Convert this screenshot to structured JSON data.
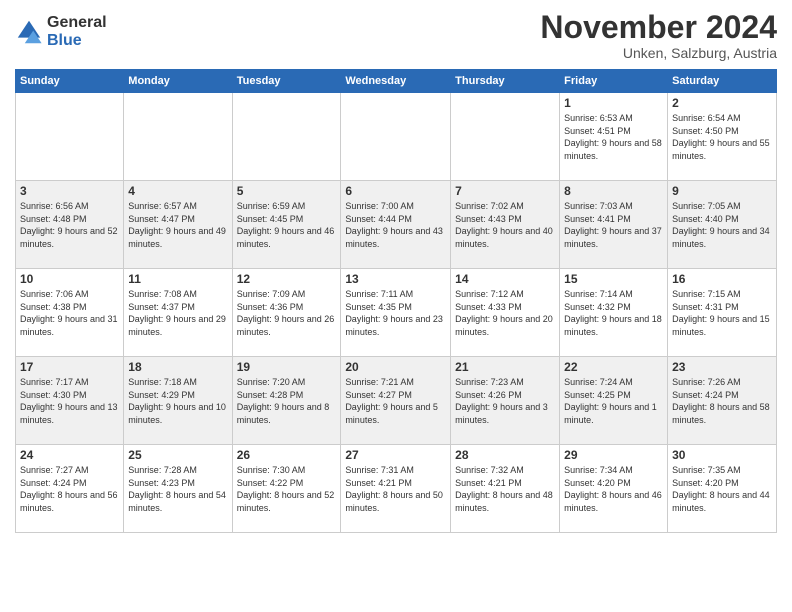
{
  "logo": {
    "general": "General",
    "blue": "Blue"
  },
  "header": {
    "title": "November 2024",
    "subtitle": "Unken, Salzburg, Austria"
  },
  "days_of_week": [
    "Sunday",
    "Monday",
    "Tuesday",
    "Wednesday",
    "Thursday",
    "Friday",
    "Saturday"
  ],
  "weeks": [
    [
      {
        "day": "",
        "info": ""
      },
      {
        "day": "",
        "info": ""
      },
      {
        "day": "",
        "info": ""
      },
      {
        "day": "",
        "info": ""
      },
      {
        "day": "",
        "info": ""
      },
      {
        "day": "1",
        "info": "Sunrise: 6:53 AM\nSunset: 4:51 PM\nDaylight: 9 hours and 58 minutes."
      },
      {
        "day": "2",
        "info": "Sunrise: 6:54 AM\nSunset: 4:50 PM\nDaylight: 9 hours and 55 minutes."
      }
    ],
    [
      {
        "day": "3",
        "info": "Sunrise: 6:56 AM\nSunset: 4:48 PM\nDaylight: 9 hours and 52 minutes."
      },
      {
        "day": "4",
        "info": "Sunrise: 6:57 AM\nSunset: 4:47 PM\nDaylight: 9 hours and 49 minutes."
      },
      {
        "day": "5",
        "info": "Sunrise: 6:59 AM\nSunset: 4:45 PM\nDaylight: 9 hours and 46 minutes."
      },
      {
        "day": "6",
        "info": "Sunrise: 7:00 AM\nSunset: 4:44 PM\nDaylight: 9 hours and 43 minutes."
      },
      {
        "day": "7",
        "info": "Sunrise: 7:02 AM\nSunset: 4:43 PM\nDaylight: 9 hours and 40 minutes."
      },
      {
        "day": "8",
        "info": "Sunrise: 7:03 AM\nSunset: 4:41 PM\nDaylight: 9 hours and 37 minutes."
      },
      {
        "day": "9",
        "info": "Sunrise: 7:05 AM\nSunset: 4:40 PM\nDaylight: 9 hours and 34 minutes."
      }
    ],
    [
      {
        "day": "10",
        "info": "Sunrise: 7:06 AM\nSunset: 4:38 PM\nDaylight: 9 hours and 31 minutes."
      },
      {
        "day": "11",
        "info": "Sunrise: 7:08 AM\nSunset: 4:37 PM\nDaylight: 9 hours and 29 minutes."
      },
      {
        "day": "12",
        "info": "Sunrise: 7:09 AM\nSunset: 4:36 PM\nDaylight: 9 hours and 26 minutes."
      },
      {
        "day": "13",
        "info": "Sunrise: 7:11 AM\nSunset: 4:35 PM\nDaylight: 9 hours and 23 minutes."
      },
      {
        "day": "14",
        "info": "Sunrise: 7:12 AM\nSunset: 4:33 PM\nDaylight: 9 hours and 20 minutes."
      },
      {
        "day": "15",
        "info": "Sunrise: 7:14 AM\nSunset: 4:32 PM\nDaylight: 9 hours and 18 minutes."
      },
      {
        "day": "16",
        "info": "Sunrise: 7:15 AM\nSunset: 4:31 PM\nDaylight: 9 hours and 15 minutes."
      }
    ],
    [
      {
        "day": "17",
        "info": "Sunrise: 7:17 AM\nSunset: 4:30 PM\nDaylight: 9 hours and 13 minutes."
      },
      {
        "day": "18",
        "info": "Sunrise: 7:18 AM\nSunset: 4:29 PM\nDaylight: 9 hours and 10 minutes."
      },
      {
        "day": "19",
        "info": "Sunrise: 7:20 AM\nSunset: 4:28 PM\nDaylight: 9 hours and 8 minutes."
      },
      {
        "day": "20",
        "info": "Sunrise: 7:21 AM\nSunset: 4:27 PM\nDaylight: 9 hours and 5 minutes."
      },
      {
        "day": "21",
        "info": "Sunrise: 7:23 AM\nSunset: 4:26 PM\nDaylight: 9 hours and 3 minutes."
      },
      {
        "day": "22",
        "info": "Sunrise: 7:24 AM\nSunset: 4:25 PM\nDaylight: 9 hours and 1 minute."
      },
      {
        "day": "23",
        "info": "Sunrise: 7:26 AM\nSunset: 4:24 PM\nDaylight: 8 hours and 58 minutes."
      }
    ],
    [
      {
        "day": "24",
        "info": "Sunrise: 7:27 AM\nSunset: 4:24 PM\nDaylight: 8 hours and 56 minutes."
      },
      {
        "day": "25",
        "info": "Sunrise: 7:28 AM\nSunset: 4:23 PM\nDaylight: 8 hours and 54 minutes."
      },
      {
        "day": "26",
        "info": "Sunrise: 7:30 AM\nSunset: 4:22 PM\nDaylight: 8 hours and 52 minutes."
      },
      {
        "day": "27",
        "info": "Sunrise: 7:31 AM\nSunset: 4:21 PM\nDaylight: 8 hours and 50 minutes."
      },
      {
        "day": "28",
        "info": "Sunrise: 7:32 AM\nSunset: 4:21 PM\nDaylight: 8 hours and 48 minutes."
      },
      {
        "day": "29",
        "info": "Sunrise: 7:34 AM\nSunset: 4:20 PM\nDaylight: 8 hours and 46 minutes."
      },
      {
        "day": "30",
        "info": "Sunrise: 7:35 AM\nSunset: 4:20 PM\nDaylight: 8 hours and 44 minutes."
      }
    ]
  ]
}
